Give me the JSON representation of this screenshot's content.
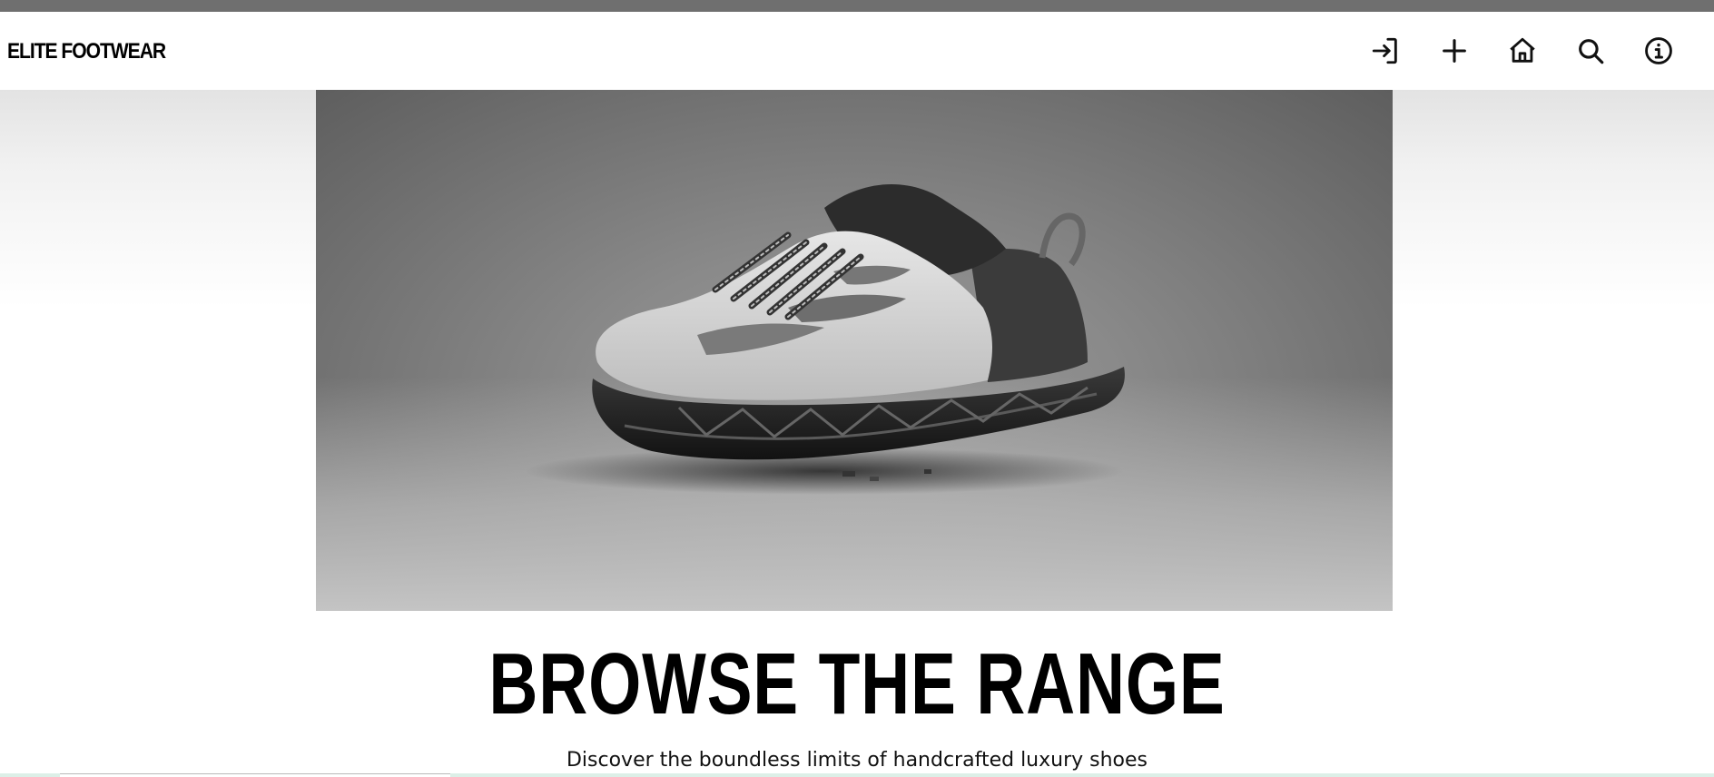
{
  "header": {
    "brand": "ELITE FOOTWEAR",
    "nav_icons": [
      {
        "name": "login-icon"
      },
      {
        "name": "plus-icon"
      },
      {
        "name": "home-icon"
      },
      {
        "name": "search-icon"
      },
      {
        "name": "info-icon"
      }
    ]
  },
  "hero": {
    "image": "shoe-product-photo",
    "headline": "BROWSE THE RANGE",
    "subheadline": "Discover the boundless limits of handcrafted luxury shoes"
  },
  "colors": {
    "top_strip": "#6f6f6f",
    "text": "#000000",
    "background": "#ffffff"
  }
}
